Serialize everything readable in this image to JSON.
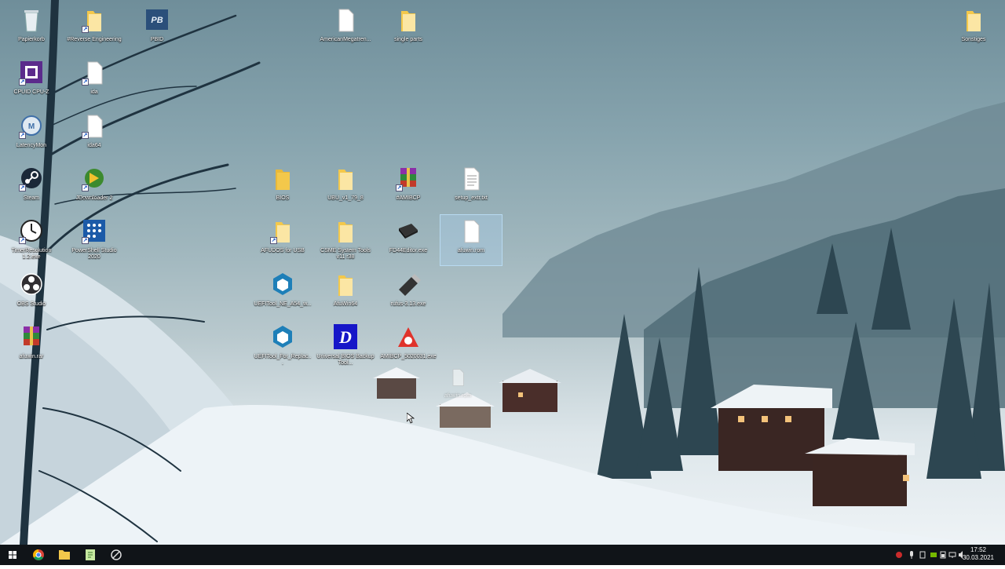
{
  "desktop": {
    "icons": [
      {
        "id": "papierkorb",
        "label": "Papierkorb",
        "type": "recycle-bin"
      },
      {
        "id": "reverse",
        "label": "#Reverse Engineering",
        "type": "folder"
      },
      {
        "id": "pbid",
        "label": "PBID",
        "type": "app"
      },
      {
        "id": "americanmegatrends",
        "label": "AmericanMegatren...",
        "type": "file"
      },
      {
        "id": "singleparts",
        "label": "single parts",
        "type": "folder"
      },
      {
        "id": "sonstiges",
        "label": "Sonstiges",
        "type": "folder"
      },
      {
        "id": "cpuz",
        "label": "CPUID CPU-Z",
        "type": "app"
      },
      {
        "id": "ida",
        "label": "ida",
        "type": "file"
      },
      {
        "id": "latencymon",
        "label": "LatencyMon",
        "type": "app"
      },
      {
        "id": "ida64",
        "label": "ida64",
        "type": "file"
      },
      {
        "id": "steam",
        "label": "Steam",
        "type": "app"
      },
      {
        "id": "jdownloader",
        "label": "JDownloader 2",
        "type": "app"
      },
      {
        "id": "bios",
        "label": "BIOS",
        "type": "folder"
      },
      {
        "id": "ubu",
        "label": "UBU_v1_79_8",
        "type": "folder"
      },
      {
        "id": "amibcp",
        "label": "#AMIBCP",
        "type": "app"
      },
      {
        "id": "setupextract",
        "label": "setup_extr.txt",
        "type": "file"
      },
      {
        "id": "timerres",
        "label": "TimerResolution 1.2.exe",
        "type": "app"
      },
      {
        "id": "powershell",
        "label": "PowerShell Studio 2020",
        "type": "app"
      },
      {
        "id": "afudos",
        "label": "AFUDOS for USB",
        "type": "folder"
      },
      {
        "id": "csme",
        "label": "CSME System Tools v11 r38",
        "type": "folder"
      },
      {
        "id": "fd44",
        "label": "FD44Editor.exe",
        "type": "app"
      },
      {
        "id": "afuwinrom",
        "label": "afuwin.rom",
        "type": "file"
      },
      {
        "id": "obs",
        "label": "OBS Studio",
        "type": "app"
      },
      {
        "id": "ueftoolne",
        "label": "UEFITool_NE_A54_w...",
        "type": "app"
      },
      {
        "id": "afuwin64",
        "label": "AfuWin64",
        "type": "folder"
      },
      {
        "id": "rufus",
        "label": "rufus-3.13.exe",
        "type": "app"
      },
      {
        "id": "afuwinrar",
        "label": "afuwin.rar",
        "type": "archive"
      },
      {
        "id": "uefitoolrepl",
        "label": "UEFITool_For_Replac...",
        "type": "app"
      },
      {
        "id": "universalbios",
        "label": "Universal BIOS Backup Tool...",
        "type": "app"
      },
      {
        "id": "amibcp5",
        "label": "AMIBCP_5020031.exe",
        "type": "app"
      }
    ],
    "drag_ghost_label": "afuwin.rom"
  },
  "taskbar": {
    "buttons": [
      {
        "id": "start",
        "icon": "windows-icon"
      },
      {
        "id": "chrome",
        "icon": "chrome-icon"
      },
      {
        "id": "explorer",
        "icon": "folder-icon"
      },
      {
        "id": "notepad",
        "icon": "notepadpp-icon"
      },
      {
        "id": "app4",
        "icon": "circle-app-icon"
      }
    ],
    "clock": {
      "time": "17:52",
      "date": "30.03.2021"
    }
  },
  "colors": {
    "taskbar": "#101418",
    "folder": "#f3c84b",
    "selection": "#add2f0"
  }
}
